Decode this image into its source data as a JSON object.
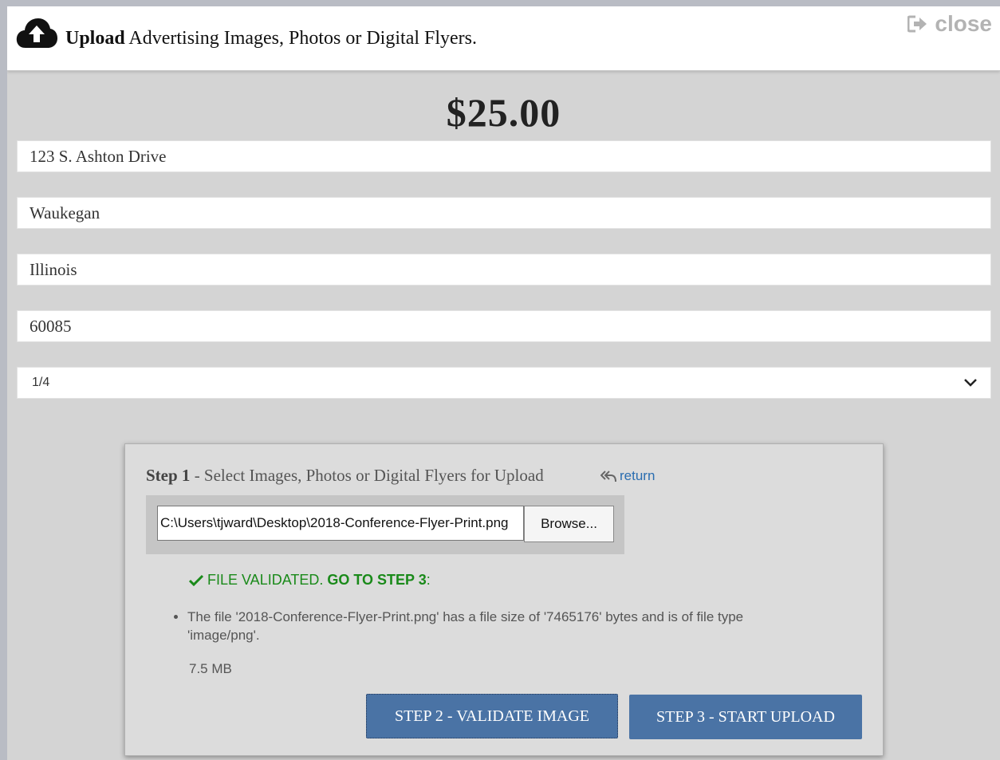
{
  "header": {
    "title_bold": "Upload",
    "title_rest": " Advertising Images, Photos or Digital Flyers.",
    "close_label": "close",
    "upload_icon": "cloud-upload-icon",
    "close_icon": "sign-out-icon"
  },
  "price": "$25.00",
  "fields": {
    "address": "123 S. Ashton Drive",
    "city": "Waukegan",
    "state": "Illinois",
    "zip": "60085",
    "size_select": "1/4"
  },
  "upload_panel": {
    "step1_label": "Step 1",
    "step1_text": " - Select Images, Photos or Digital Flyers for Upload",
    "return_label": "return",
    "file_path": "C:\\Users\\tjward\\Desktop\\2018-Conference-Flyer-Print.png",
    "browse_label": "Browse...",
    "validated_label": "FILE VALIDATED.",
    "validated_next": "GO TO STEP 3",
    "validated_suffix": ":",
    "file_info": "The file '2018-Conference-Flyer-Print.png' has a file size of '7465176' bytes and is of file type 'image/png'.",
    "file_size": "7.5 MB",
    "validate_button": "STEP 2 - VALIDATE IMAGE",
    "upload_button": "STEP 3 - START UPLOAD"
  },
  "colors": {
    "button_blue": "#4a73a5",
    "success_green": "#1a8a1a",
    "link_blue": "#2a6db0"
  }
}
